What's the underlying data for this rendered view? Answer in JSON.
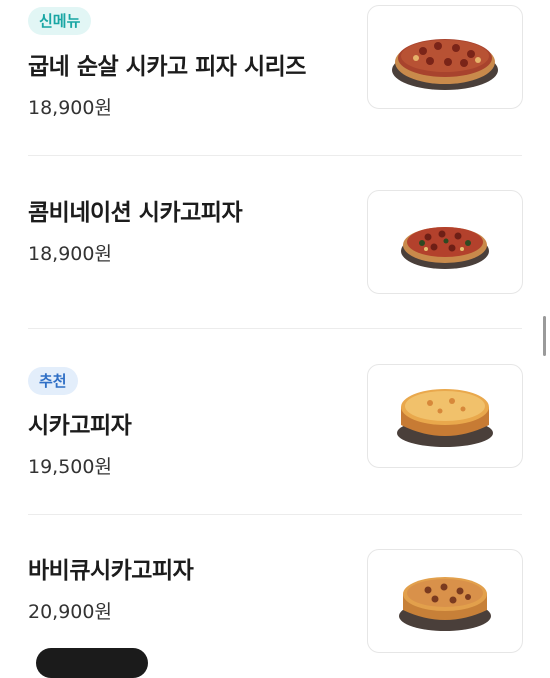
{
  "menu": {
    "items": [
      {
        "badge": "신메뉴",
        "name": "굽네 순살 시카고 피자 시리즈",
        "price": "18,900원",
        "image": "chicago-pizza-boneless-series"
      },
      {
        "badge": "",
        "name": "콤비네이션 시카고피자",
        "price": "18,900원",
        "image": "combination-chicago-pizza"
      },
      {
        "badge": "추천",
        "name": "시카고피자",
        "price": "19,500원",
        "image": "chicago-pizza"
      },
      {
        "badge": "",
        "name": "바비큐시카고피자",
        "price": "20,900원",
        "image": "bbq-chicago-pizza"
      }
    ]
  },
  "colors": {
    "badge_new_text": "#19a6a4",
    "badge_new_bg": "#e2f6f5",
    "badge_recommend_text": "#2f6fc6",
    "badge_recommend_bg": "#e3eefb"
  }
}
